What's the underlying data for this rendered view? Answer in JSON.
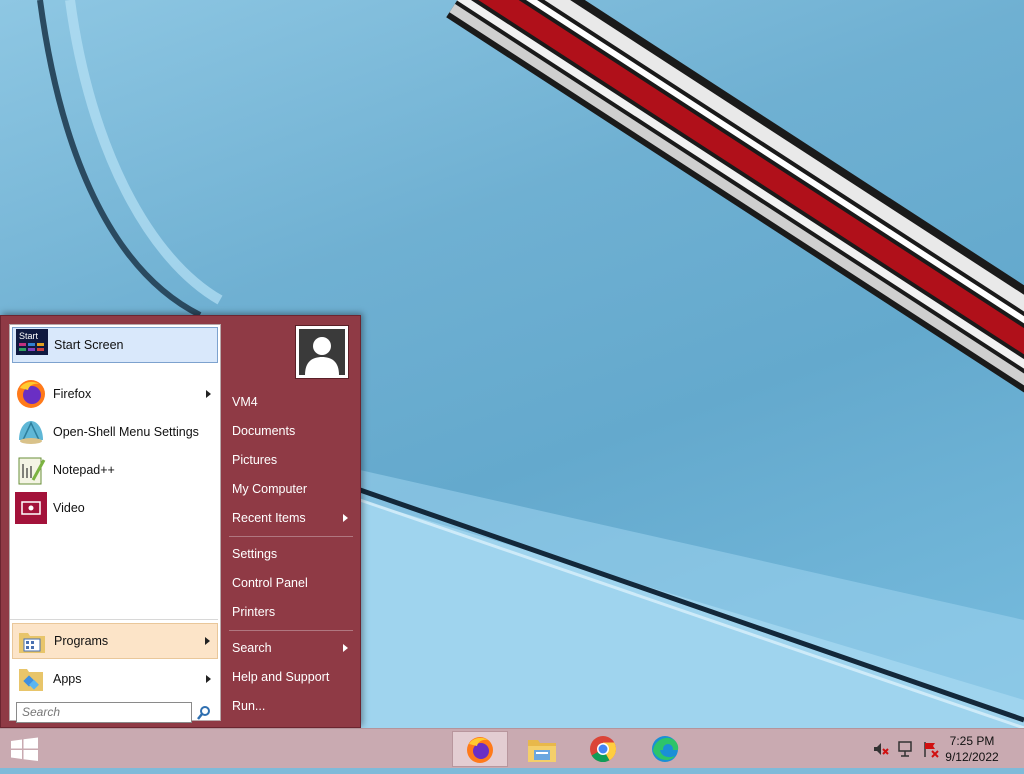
{
  "start_menu": {
    "left_items": [
      {
        "label": "Start Screen"
      },
      {
        "label": "Firefox"
      },
      {
        "label": "Open-Shell Menu Settings"
      },
      {
        "label": "Notepad++"
      },
      {
        "label": "Video"
      }
    ],
    "start_tile_text": "Start",
    "programs_label": "Programs",
    "apps_label": "Apps",
    "search_placeholder": "Search",
    "right_items": {
      "user": "VM4",
      "documents": "Documents",
      "pictures": "Pictures",
      "my_computer": "My Computer",
      "recent_items": "Recent Items",
      "settings": "Settings",
      "control_panel": "Control Panel",
      "printers": "Printers",
      "search": "Search",
      "help": "Help and Support",
      "run": "Run..."
    }
  },
  "taskbar": {
    "time": "7:25 PM",
    "date": "9/12/2022",
    "apps": [
      "firefox-icon",
      "file-explorer-icon",
      "chrome-icon",
      "edge-icon"
    ]
  },
  "colors": {
    "menu_bg": "#8f3a45",
    "taskbar_bg": "#c9aab1",
    "selection": "#d9e8fb",
    "programs_highlight": "#fce4c8"
  }
}
